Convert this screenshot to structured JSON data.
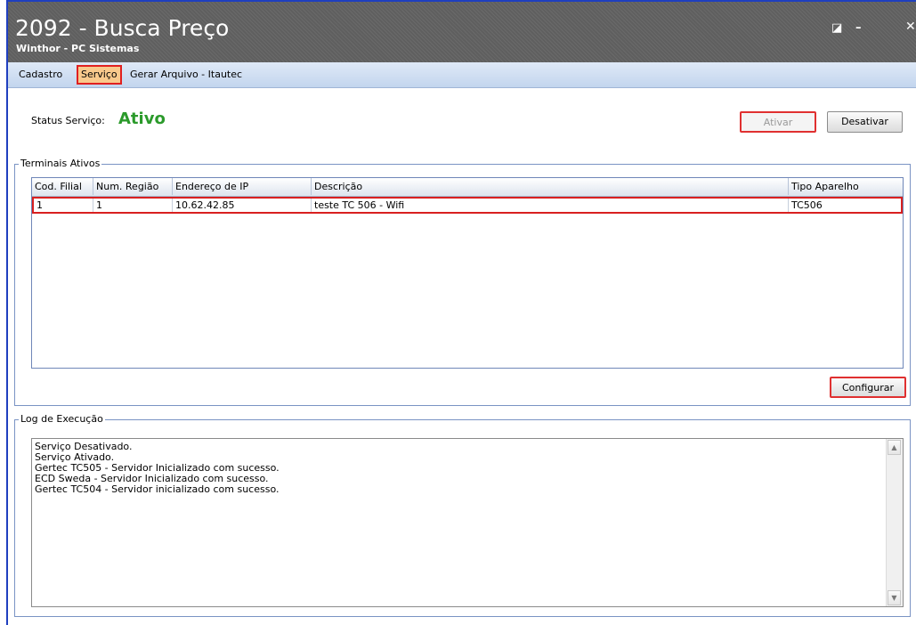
{
  "window": {
    "title": "2092 - Busca Preço",
    "subtitle": "Winthor - PC Sistemas",
    "restore_glyph": "◪",
    "minimize_glyph": "–",
    "close_glyph": "✕"
  },
  "menu": {
    "items": [
      {
        "label": "Cadastro"
      },
      {
        "label": "Serviço"
      },
      {
        "label": "Gerar Arquivo - Itautec"
      }
    ]
  },
  "status": {
    "label": "Status Serviço:",
    "value": "Ativo"
  },
  "buttons": {
    "ativar": "Ativar",
    "desativar": "Desativar",
    "configurar": "Configurar"
  },
  "terminais": {
    "group_label": "Terminais Ativos",
    "columns": [
      "Cod. Filial",
      "Num. Região",
      "Endereço de IP",
      "Descrição",
      "Tipo Aparelho"
    ],
    "rows": [
      [
        "1",
        "1",
        "10.62.42.85",
        "teste TC 506 - Wifi",
        "TC506"
      ]
    ]
  },
  "log": {
    "group_label": "Log de Execução",
    "lines": [
      "Serviço Desativado.",
      "Serviço Ativado.",
      "Gertec TC505 - Servidor Inicializado com sucesso.",
      "ECD Sweda - Servidor Inicializado com sucesso.",
      "Gertec TC504 - Servidor inicializado com sucesso."
    ]
  },
  "colors": {
    "status_active": "#2b9a2b",
    "highlight": "#e03030",
    "titlebar": "#666666"
  }
}
